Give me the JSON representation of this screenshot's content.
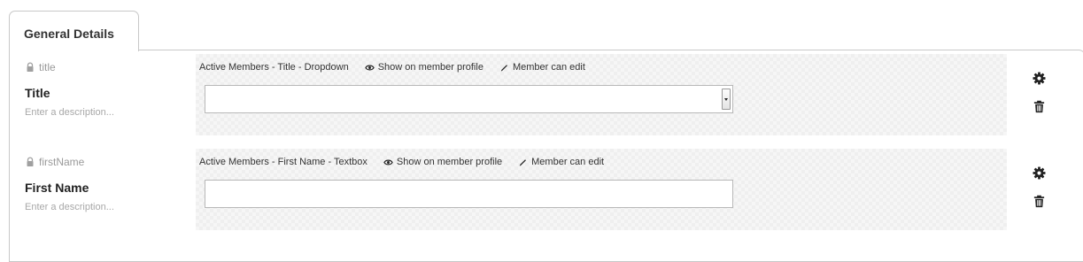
{
  "tab": {
    "label": "General Details"
  },
  "fields": [
    {
      "alias": "title",
      "name": "Title",
      "description": "Enter a description...",
      "property_type": "Active Members - Title - Dropdown",
      "show_on_profile": "Show on member profile",
      "member_can_edit": "Member can edit",
      "control": "dropdown",
      "value": ""
    },
    {
      "alias": "firstName",
      "name": "First Name",
      "description": "Enter a description...",
      "property_type": "Active Members - First Name - Textbox",
      "show_on_profile": "Show on member profile",
      "member_can_edit": "Member can edit",
      "control": "textbox",
      "value": ""
    }
  ],
  "icons": {
    "lock": "lock-icon",
    "eye": "eye-icon",
    "pencil": "pencil-icon",
    "settings": "gear-icon",
    "delete": "trash-icon"
  },
  "colors": {
    "border": "#c8c8c8",
    "muted_text": "#9a9a9a",
    "icon": "#222222"
  }
}
